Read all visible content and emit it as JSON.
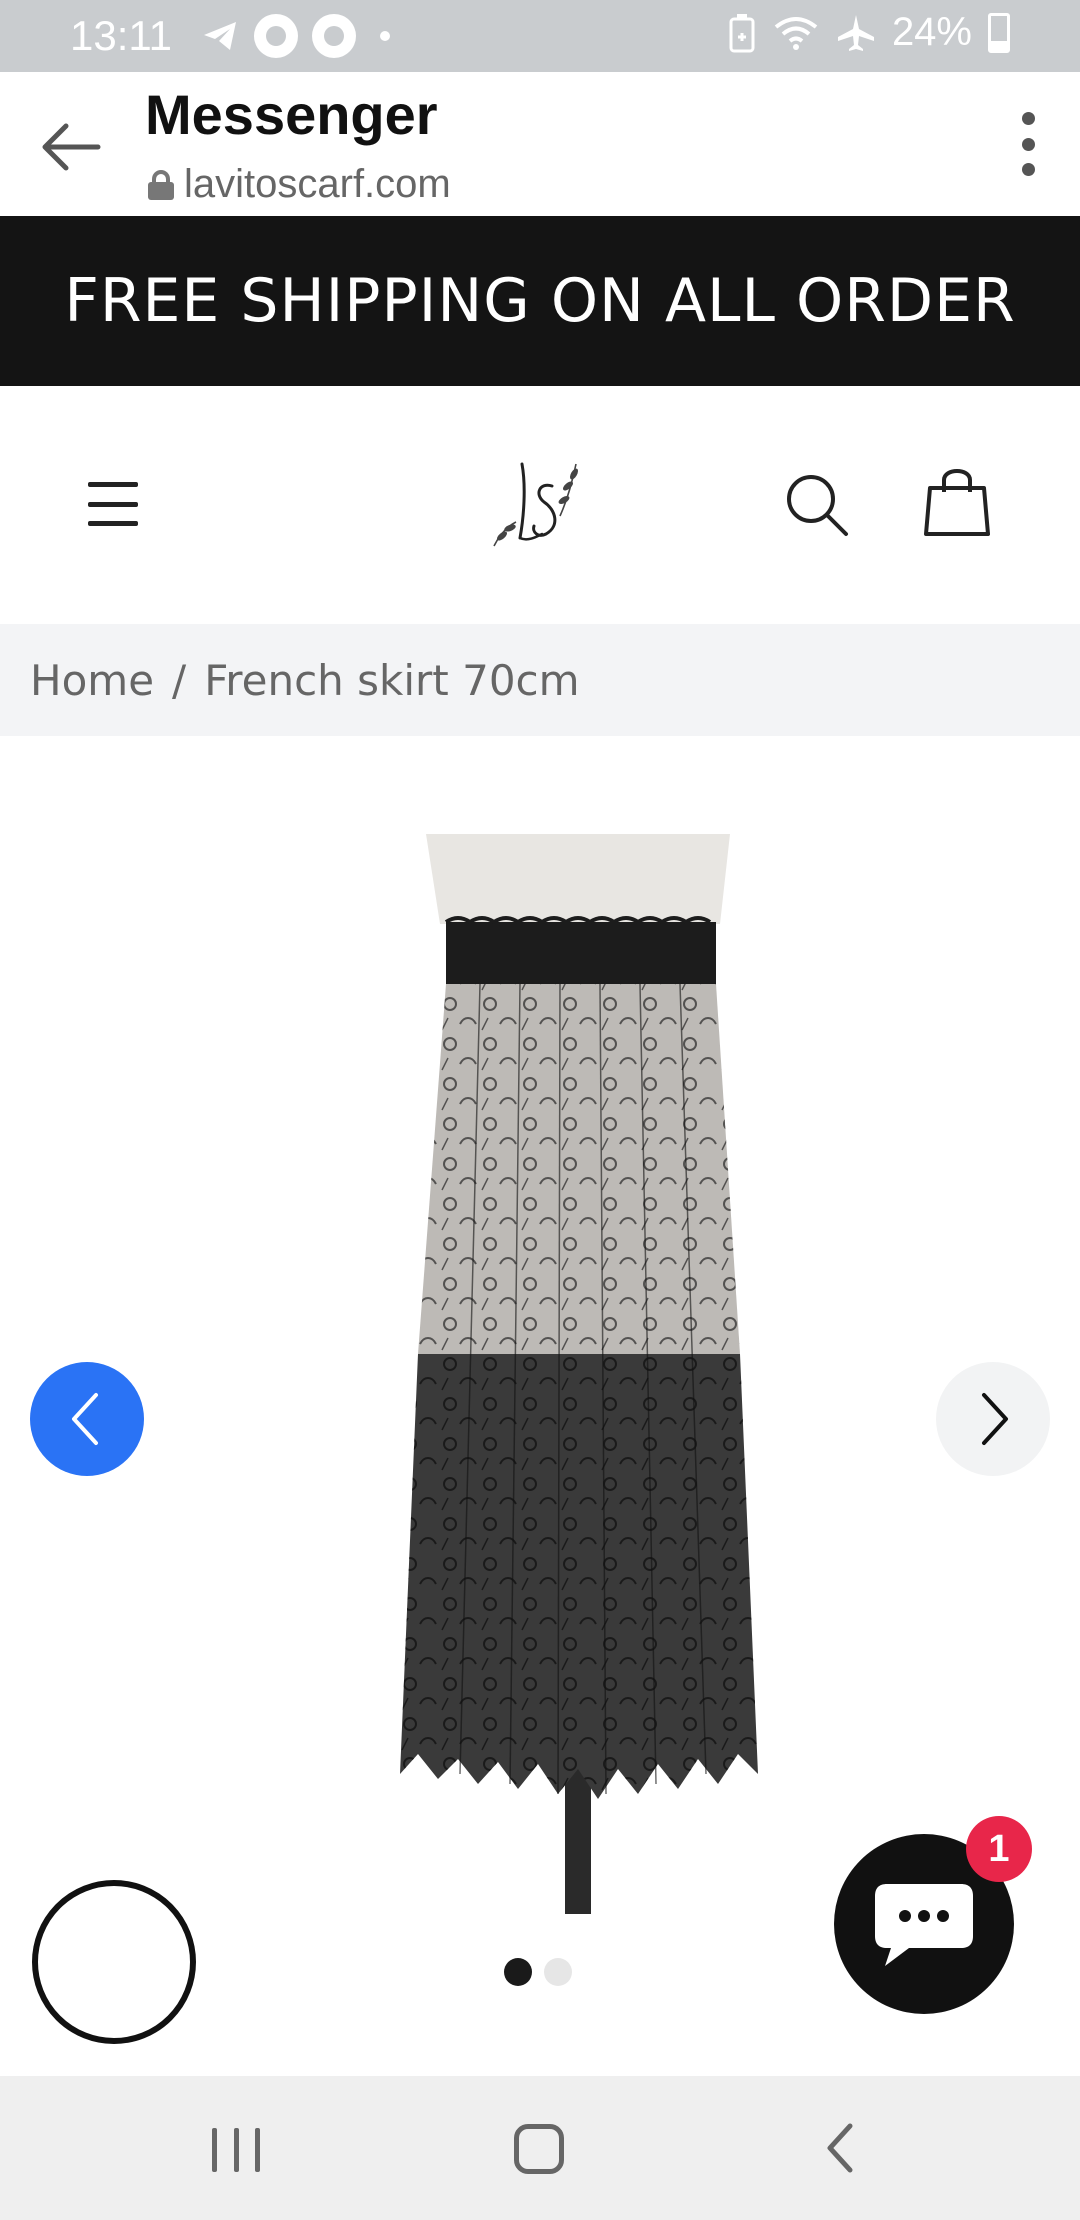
{
  "status_bar": {
    "time": "13:11",
    "battery": "24%",
    "icons": [
      "telegram-icon",
      "messenger-icon",
      "messenger-icon",
      "dot-icon",
      "battery-saver-icon",
      "wifi-icon",
      "airplane-mode-icon",
      "battery-icon"
    ]
  },
  "browser": {
    "title": "Messenger",
    "url": "lavitoscarf.com"
  },
  "banner": {
    "text": "FREE SHIPPING ON ALL ORDER",
    "background": "#141414",
    "color": "#ffffff"
  },
  "store_header": {
    "logo_icon": "ls-monogram-logo",
    "menu_icon": "hamburger-menu-icon",
    "search_icon": "search-icon",
    "cart_icon": "shopping-bag-icon"
  },
  "breadcrumb": {
    "items": [
      "Home",
      "French skirt 70cm"
    ],
    "separator": "/"
  },
  "gallery": {
    "image_alt": "Black lace midi skirt on mannequin",
    "slide_count": 2,
    "active_slide": 1,
    "prev_color": "#2a73f5",
    "next_color": "#f2f3f4"
  },
  "chat": {
    "badge_count": "1",
    "badge_color": "#e8264a"
  },
  "nav_bar": {
    "icons": [
      "recents-icon",
      "home-icon",
      "back-icon"
    ]
  }
}
